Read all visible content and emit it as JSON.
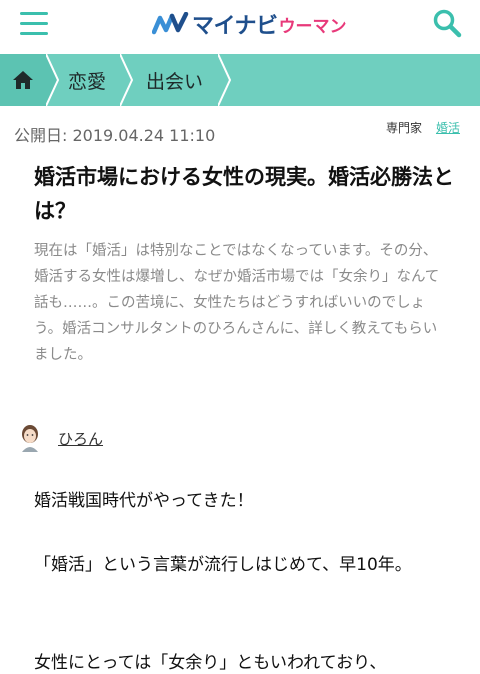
{
  "header": {
    "logo_main": "マイナビ",
    "logo_sub": "ウーマン",
    "brand_color": "#3bbfad"
  },
  "breadcrumb": {
    "items": [
      {
        "label": "恋愛"
      },
      {
        "label": "出会い"
      }
    ]
  },
  "meta": {
    "published": "公開日: 2019.04.24 11:10",
    "expert_label": "専門家",
    "tag_label": "婚活"
  },
  "article": {
    "title": "婚活市場における女性の現実。婚活必勝法とは？",
    "lead": "現在は「婚活」は特別なことではなくなっています。その分、婚活する女性は爆増し、なぜか婚活市場では「女余り」なんて話も……。この苦境に、女性たちはどうすればいいのでしょう。婚活コンサルタントのひろんさんに、詳しく教えてもらいました。",
    "author": "ひろん",
    "paragraphs": [
      "婚活戦国時代がやってきた！",
      "「婚活」という言葉が流行しはじめて、早10年。",
      "女性にとっては「女余り」ともいわれており、"
    ]
  }
}
